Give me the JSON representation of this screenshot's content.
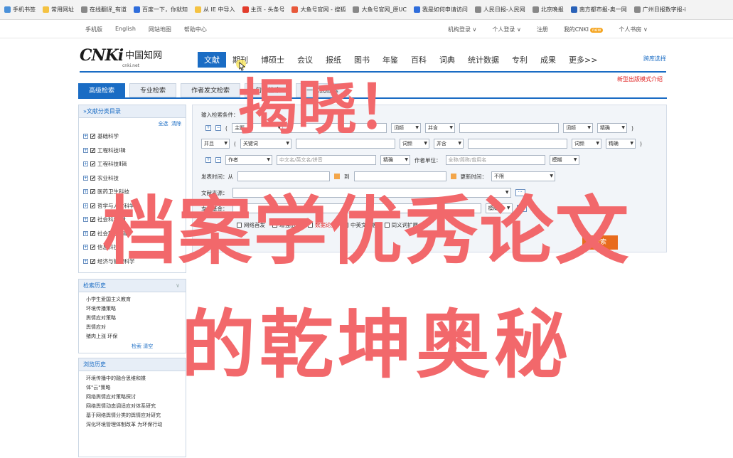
{
  "bookmarks": [
    {
      "label": "手机书签",
      "icon": "phone-icon",
      "color": "#4a90d9"
    },
    {
      "label": "常用网址",
      "icon": "folder-icon",
      "color": "#f4c242"
    },
    {
      "label": "在线翻译_有道",
      "icon": "globe-icon",
      "color": "#888888"
    },
    {
      "label": "百度一下，你就知",
      "icon": "baidu-icon",
      "color": "#2f6ddb"
    },
    {
      "label": "从 IE 中导入",
      "icon": "folder-icon",
      "color": "#f4c242"
    },
    {
      "label": "主页 - 头条号",
      "icon": "toutiao-icon",
      "color": "#e23c2c"
    },
    {
      "label": "大鱼号官网 - 搜狐",
      "icon": "dayu-icon",
      "color": "#e8583a"
    },
    {
      "label": "大鱼号官网_原UC",
      "icon": "globe-icon",
      "color": "#888888"
    },
    {
      "label": "我是如何申请访问",
      "icon": "zhihu-icon",
      "color": "#2f6ddb"
    },
    {
      "label": "人民日报-人民网",
      "icon": "globe-icon",
      "color": "#888888"
    },
    {
      "label": "北京晚报",
      "icon": "globe-icon",
      "color": "#888888"
    },
    {
      "label": "南方都市报-奥一网",
      "icon": "nandu-icon",
      "color": "#2a62b8"
    },
    {
      "label": "广州日报数字报-i",
      "icon": "globe-icon",
      "color": "#888888"
    }
  ],
  "topnav": {
    "left": [
      "手机版",
      "English",
      "网站地图",
      "帮助中心"
    ],
    "right": [
      "机构登录 ∨",
      "个人登录 ∨",
      "注册",
      "我的CNKI",
      "个人书房 ∨"
    ],
    "new_badge": "new"
  },
  "logo": {
    "main": "CNKi",
    "cn": "中国知网",
    "sub": "cnki.net"
  },
  "categories": [
    "文献",
    "期刊",
    "博硕士",
    "会议",
    "报纸",
    "图书",
    "年鉴",
    "百科",
    "词典",
    "统计数据",
    "专利",
    "成果",
    "更多>>"
  ],
  "cross_select": "跨库选择",
  "new_mode": "新型出版模式介绍",
  "tabs": [
    "高级检索",
    "专业检索",
    "作者发文检索",
    "句子检索",
    "一框式检索"
  ],
  "sidebar": {
    "title": "»文献分类目录",
    "select_all": "全选",
    "clear": "清除",
    "items": [
      "基础科学",
      "工程科技Ⅰ辑",
      "工程科技Ⅱ辑",
      "农业科技",
      "医药卫生科技",
      "哲学与人文科学",
      "社会科学Ⅰ辑",
      "社会科学Ⅱ辑",
      "信息科技",
      "经济与管理科学"
    ],
    "history_title": "检索历史",
    "history": [
      "小学生爱国主义教育",
      "环境传播策略",
      "舆情应对策略",
      "舆情应对",
      "猪肉上涨 环保"
    ],
    "history_foot": "检索 清空",
    "browse_title": "浏览历史",
    "browse": [
      "环境传播中的融合思维和媒",
      "体\"云\"策略",
      "网络舆情应对策略探讨",
      "网络舆情动态调适应对体系研究",
      "基于网络舆情分类的舆情应对研究",
      "深化环境管理体制改革 为环保行动"
    ]
  },
  "form": {
    "conditions_label": "输入检索条件：",
    "row1": {
      "field": "主题",
      "match1": "词频",
      "op": "并含",
      "match2": "词频",
      "exact": "精确"
    },
    "row2": {
      "logic": "并且",
      "field": "关键词",
      "match1": "词频",
      "op": "并含",
      "match2": "词频",
      "exact": "精确"
    },
    "row3": {
      "field": "作者",
      "author_ph": "中文名/英文名/拼音",
      "exact": "精确",
      "org_label": "作者单位：",
      "org_ph": "全称/简称/曾用名",
      "fuzzy": "模糊"
    },
    "date_label": "发表时间：从",
    "date_to": "到",
    "update_label": "更新时间：",
    "update_value": "不限",
    "source_label": "文献来源：",
    "fund_label": "支持基金：",
    "fund_match": "模糊",
    "options": [
      "网络首发",
      "增强出版",
      "数据论文",
      "中英文扩展",
      "同义词扩展"
    ],
    "search_label": "检索"
  },
  "overlay": {
    "line1": "揭晓！",
    "line2": "档案学优秀论文",
    "line3": "的乾坤奥秘",
    "color": "#f2686b"
  }
}
